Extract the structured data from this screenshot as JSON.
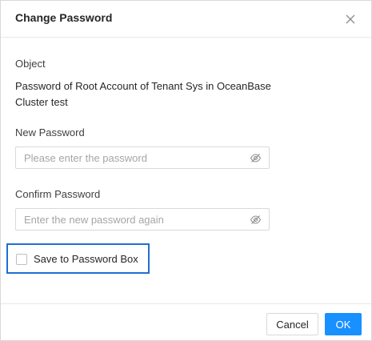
{
  "dialog": {
    "title": "Change Password",
    "close_icon": "close-icon"
  },
  "object": {
    "label": "Object",
    "value": "Password of Root Account of Tenant Sys in OceanBase Cluster test"
  },
  "new_password": {
    "label": "New Password",
    "value": "",
    "placeholder": "Please enter the password",
    "toggle_icon": "eye-slash-icon"
  },
  "confirm_password": {
    "label": "Confirm Password",
    "value": "",
    "placeholder": "Enter the new password again",
    "toggle_icon": "eye-slash-icon"
  },
  "save_option": {
    "label": "Save to Password Box",
    "checked": false,
    "highlight_color": "#1f6fd1"
  },
  "footer": {
    "cancel_label": "Cancel",
    "ok_label": "OK",
    "ok_color": "#1890ff"
  }
}
